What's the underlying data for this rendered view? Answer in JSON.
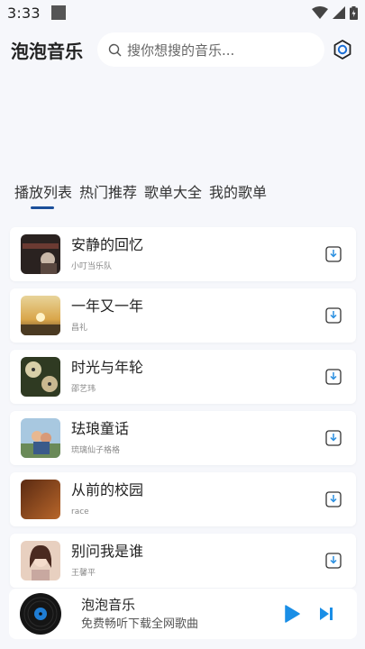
{
  "status": {
    "time": "3:33"
  },
  "header": {
    "app_title": "泡泡音乐",
    "search_placeholder": "搜你想搜的音乐..."
  },
  "tabs": [
    {
      "label": "播放列表",
      "active": true
    },
    {
      "label": "热门推荐",
      "active": false
    },
    {
      "label": "歌单大全",
      "active": false
    },
    {
      "label": "我的歌单",
      "active": false
    }
  ],
  "songs": [
    {
      "title": "安静的回忆",
      "artist": "小叮当乐队"
    },
    {
      "title": "一年又一年",
      "artist": "昌礼"
    },
    {
      "title": "时光与年轮",
      "artist": "邵艺玮"
    },
    {
      "title": "珐琅童话",
      "artist": "琉璃仙子格格"
    },
    {
      "title": "从前的校园",
      "artist": "race"
    },
    {
      "title": "别问我是谁",
      "artist": "王馨平"
    }
  ],
  "player": {
    "title": "泡泡音乐",
    "subtitle": "免费畅听下载全网歌曲"
  },
  "colors": {
    "accent": "#1b4f9a",
    "play": "#1a8ee6",
    "background": "#f6f7fb"
  }
}
